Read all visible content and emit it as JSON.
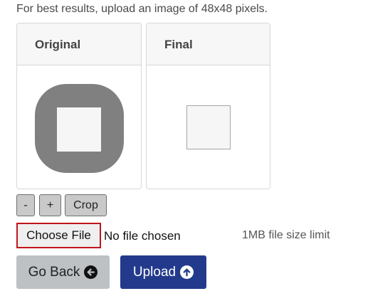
{
  "hint": "For best results, upload an image of 48x48 pixels.",
  "panels": {
    "original_title": "Original",
    "final_title": "Final"
  },
  "crop_controls": {
    "zoom_out": "-",
    "zoom_in": "+",
    "crop": "Crop"
  },
  "file_input": {
    "button_label": "Choose File",
    "status": "No file chosen",
    "size_limit": "1MB file size limit"
  },
  "actions": {
    "go_back": "Go Back",
    "go_back_icon": "arrow-left-circle-icon",
    "upload": "Upload",
    "upload_icon": "arrow-up-circle-icon"
  },
  "colors": {
    "upload_button": "#233a8c",
    "go_back_button": "#bdc1c4",
    "choose_file_border": "#c0141a"
  }
}
